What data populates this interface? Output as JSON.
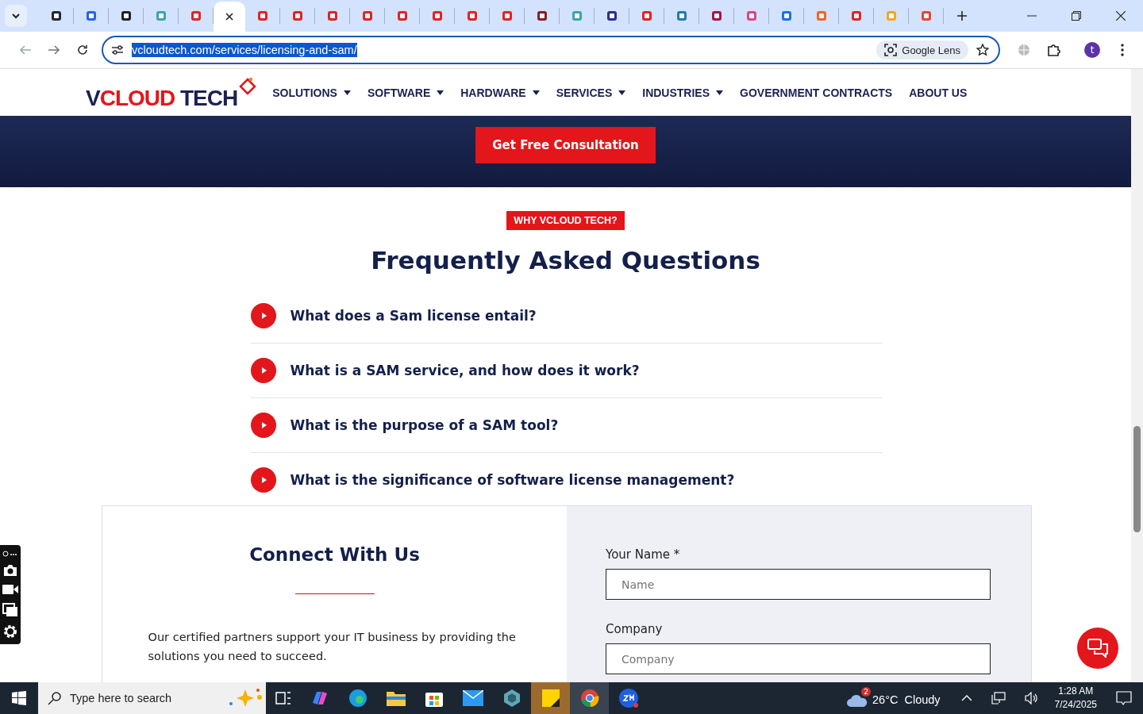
{
  "browser": {
    "tabs": [
      {
        "selected": false,
        "color": "#1f2937"
      },
      {
        "selected": false,
        "color": "#2563eb"
      },
      {
        "selected": false,
        "color": "#222222"
      },
      {
        "selected": false,
        "color": "#3aa6a8"
      },
      {
        "selected": false,
        "color": "#e02424"
      },
      {
        "selected": true
      },
      {
        "selected": false,
        "color": "#e02424"
      },
      {
        "selected": false,
        "color": "#e02424"
      },
      {
        "selected": false,
        "color": "#e02424"
      },
      {
        "selected": false,
        "color": "#e02424"
      },
      {
        "selected": false,
        "color": "#e02424"
      },
      {
        "selected": false,
        "color": "#e02424"
      },
      {
        "selected": false,
        "color": "#e02424"
      },
      {
        "selected": false,
        "color": "#e02424"
      },
      {
        "selected": false,
        "color": "#8b1a2b"
      },
      {
        "selected": false,
        "color": "#3aa6a8"
      },
      {
        "selected": false,
        "color": "#2b2f8f"
      },
      {
        "selected": false,
        "color": "#e02424"
      },
      {
        "selected": false,
        "color": "#1e7fa8"
      },
      {
        "selected": false,
        "color": "#a3144a"
      },
      {
        "selected": false,
        "color": "#e0448a"
      },
      {
        "selected": false,
        "color": "#1a73e8"
      },
      {
        "selected": false,
        "color": "#f26522"
      },
      {
        "selected": false,
        "color": "#e02424"
      },
      {
        "selected": false,
        "color": "#f5a623"
      },
      {
        "selected": false,
        "color": "#ea4335"
      }
    ],
    "url": "vcloudtech.com/services/licensing-and-sam/",
    "lens_label": "Google Lens",
    "profile_initial": "t"
  },
  "site": {
    "logo": [
      {
        "text": "V",
        "color": "#1b2150"
      },
      {
        "text": "CLOUD",
        "color": "#e3161b"
      },
      {
        "text": " TECH",
        "color": "#1b2150"
      }
    ],
    "nav": [
      {
        "label": "SOLUTIONS",
        "dropdown": true
      },
      {
        "label": "SOFTWARE",
        "dropdown": true
      },
      {
        "label": "HARDWARE",
        "dropdown": true
      },
      {
        "label": "SERVICES",
        "dropdown": true
      },
      {
        "label": "INDUSTRIES",
        "dropdown": true
      },
      {
        "label": "GOVERNMENT CONTRACTS",
        "dropdown": false
      },
      {
        "label": "ABOUT US",
        "dropdown": false
      }
    ],
    "cta": "Get Free Consultation",
    "badge": "WHY VCLOUD TECH?",
    "heading": "Frequently Asked Questions",
    "faqs": [
      {
        "question": "What does a Sam license entail?",
        "expanded": false
      },
      {
        "question": "What is a SAM service, and how does it work?",
        "expanded": false
      },
      {
        "question": "What is the purpose of a SAM tool?",
        "expanded": false
      },
      {
        "question": "What is the significance of software license management?",
        "expanded": false
      }
    ],
    "connect": {
      "heading": "Connect With Us",
      "text": "Our certified partners support your IT business by providing the solutions you need to succeed.",
      "fields": [
        {
          "label": "Your Name *",
          "placeholder": "Name"
        },
        {
          "label": "Company",
          "placeholder": "Company"
        }
      ]
    }
  },
  "taskbar": {
    "search_placeholder": "Type here to search",
    "weather_badge": "2",
    "weather": "26°C  Cloudy",
    "time": "1:28 AM",
    "date": "7/24/2025"
  }
}
